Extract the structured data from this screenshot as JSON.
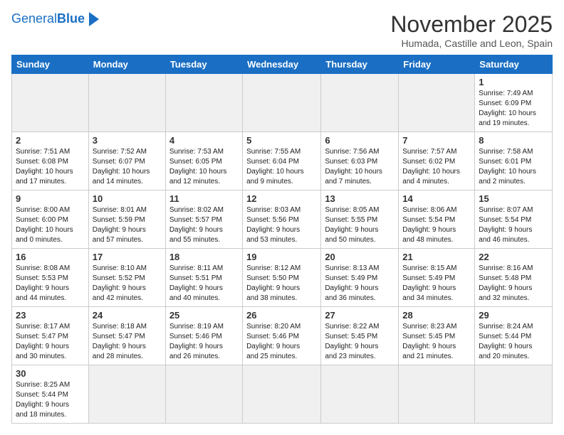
{
  "header": {
    "logo_text_general": "General",
    "logo_text_blue": "Blue",
    "month_title": "November 2025",
    "location": "Humada, Castille and Leon, Spain"
  },
  "weekdays": [
    "Sunday",
    "Monday",
    "Tuesday",
    "Wednesday",
    "Thursday",
    "Friday",
    "Saturday"
  ],
  "weeks": [
    [
      {
        "day": "",
        "info": ""
      },
      {
        "day": "",
        "info": ""
      },
      {
        "day": "",
        "info": ""
      },
      {
        "day": "",
        "info": ""
      },
      {
        "day": "",
        "info": ""
      },
      {
        "day": "",
        "info": ""
      },
      {
        "day": "1",
        "info": "Sunrise: 7:49 AM\nSunset: 6:09 PM\nDaylight: 10 hours\nand 19 minutes."
      }
    ],
    [
      {
        "day": "2",
        "info": "Sunrise: 7:51 AM\nSunset: 6:08 PM\nDaylight: 10 hours\nand 17 minutes."
      },
      {
        "day": "3",
        "info": "Sunrise: 7:52 AM\nSunset: 6:07 PM\nDaylight: 10 hours\nand 14 minutes."
      },
      {
        "day": "4",
        "info": "Sunrise: 7:53 AM\nSunset: 6:05 PM\nDaylight: 10 hours\nand 12 minutes."
      },
      {
        "day": "5",
        "info": "Sunrise: 7:55 AM\nSunset: 6:04 PM\nDaylight: 10 hours\nand 9 minutes."
      },
      {
        "day": "6",
        "info": "Sunrise: 7:56 AM\nSunset: 6:03 PM\nDaylight: 10 hours\nand 7 minutes."
      },
      {
        "day": "7",
        "info": "Sunrise: 7:57 AM\nSunset: 6:02 PM\nDaylight: 10 hours\nand 4 minutes."
      },
      {
        "day": "8",
        "info": "Sunrise: 7:58 AM\nSunset: 6:01 PM\nDaylight: 10 hours\nand 2 minutes."
      }
    ],
    [
      {
        "day": "9",
        "info": "Sunrise: 8:00 AM\nSunset: 6:00 PM\nDaylight: 10 hours\nand 0 minutes."
      },
      {
        "day": "10",
        "info": "Sunrise: 8:01 AM\nSunset: 5:59 PM\nDaylight: 9 hours\nand 57 minutes."
      },
      {
        "day": "11",
        "info": "Sunrise: 8:02 AM\nSunset: 5:57 PM\nDaylight: 9 hours\nand 55 minutes."
      },
      {
        "day": "12",
        "info": "Sunrise: 8:03 AM\nSunset: 5:56 PM\nDaylight: 9 hours\nand 53 minutes."
      },
      {
        "day": "13",
        "info": "Sunrise: 8:05 AM\nSunset: 5:55 PM\nDaylight: 9 hours\nand 50 minutes."
      },
      {
        "day": "14",
        "info": "Sunrise: 8:06 AM\nSunset: 5:54 PM\nDaylight: 9 hours\nand 48 minutes."
      },
      {
        "day": "15",
        "info": "Sunrise: 8:07 AM\nSunset: 5:54 PM\nDaylight: 9 hours\nand 46 minutes."
      }
    ],
    [
      {
        "day": "16",
        "info": "Sunrise: 8:08 AM\nSunset: 5:53 PM\nDaylight: 9 hours\nand 44 minutes."
      },
      {
        "day": "17",
        "info": "Sunrise: 8:10 AM\nSunset: 5:52 PM\nDaylight: 9 hours\nand 42 minutes."
      },
      {
        "day": "18",
        "info": "Sunrise: 8:11 AM\nSunset: 5:51 PM\nDaylight: 9 hours\nand 40 minutes."
      },
      {
        "day": "19",
        "info": "Sunrise: 8:12 AM\nSunset: 5:50 PM\nDaylight: 9 hours\nand 38 minutes."
      },
      {
        "day": "20",
        "info": "Sunrise: 8:13 AM\nSunset: 5:49 PM\nDaylight: 9 hours\nand 36 minutes."
      },
      {
        "day": "21",
        "info": "Sunrise: 8:15 AM\nSunset: 5:49 PM\nDaylight: 9 hours\nand 34 minutes."
      },
      {
        "day": "22",
        "info": "Sunrise: 8:16 AM\nSunset: 5:48 PM\nDaylight: 9 hours\nand 32 minutes."
      }
    ],
    [
      {
        "day": "23",
        "info": "Sunrise: 8:17 AM\nSunset: 5:47 PM\nDaylight: 9 hours\nand 30 minutes."
      },
      {
        "day": "24",
        "info": "Sunrise: 8:18 AM\nSunset: 5:47 PM\nDaylight: 9 hours\nand 28 minutes."
      },
      {
        "day": "25",
        "info": "Sunrise: 8:19 AM\nSunset: 5:46 PM\nDaylight: 9 hours\nand 26 minutes."
      },
      {
        "day": "26",
        "info": "Sunrise: 8:20 AM\nSunset: 5:46 PM\nDaylight: 9 hours\nand 25 minutes."
      },
      {
        "day": "27",
        "info": "Sunrise: 8:22 AM\nSunset: 5:45 PM\nDaylight: 9 hours\nand 23 minutes."
      },
      {
        "day": "28",
        "info": "Sunrise: 8:23 AM\nSunset: 5:45 PM\nDaylight: 9 hours\nand 21 minutes."
      },
      {
        "day": "29",
        "info": "Sunrise: 8:24 AM\nSunset: 5:44 PM\nDaylight: 9 hours\nand 20 minutes."
      }
    ],
    [
      {
        "day": "30",
        "info": "Sunrise: 8:25 AM\nSunset: 5:44 PM\nDaylight: 9 hours\nand 18 minutes."
      },
      {
        "day": "",
        "info": ""
      },
      {
        "day": "",
        "info": ""
      },
      {
        "day": "",
        "info": ""
      },
      {
        "day": "",
        "info": ""
      },
      {
        "day": "",
        "info": ""
      },
      {
        "day": "",
        "info": ""
      }
    ]
  ]
}
